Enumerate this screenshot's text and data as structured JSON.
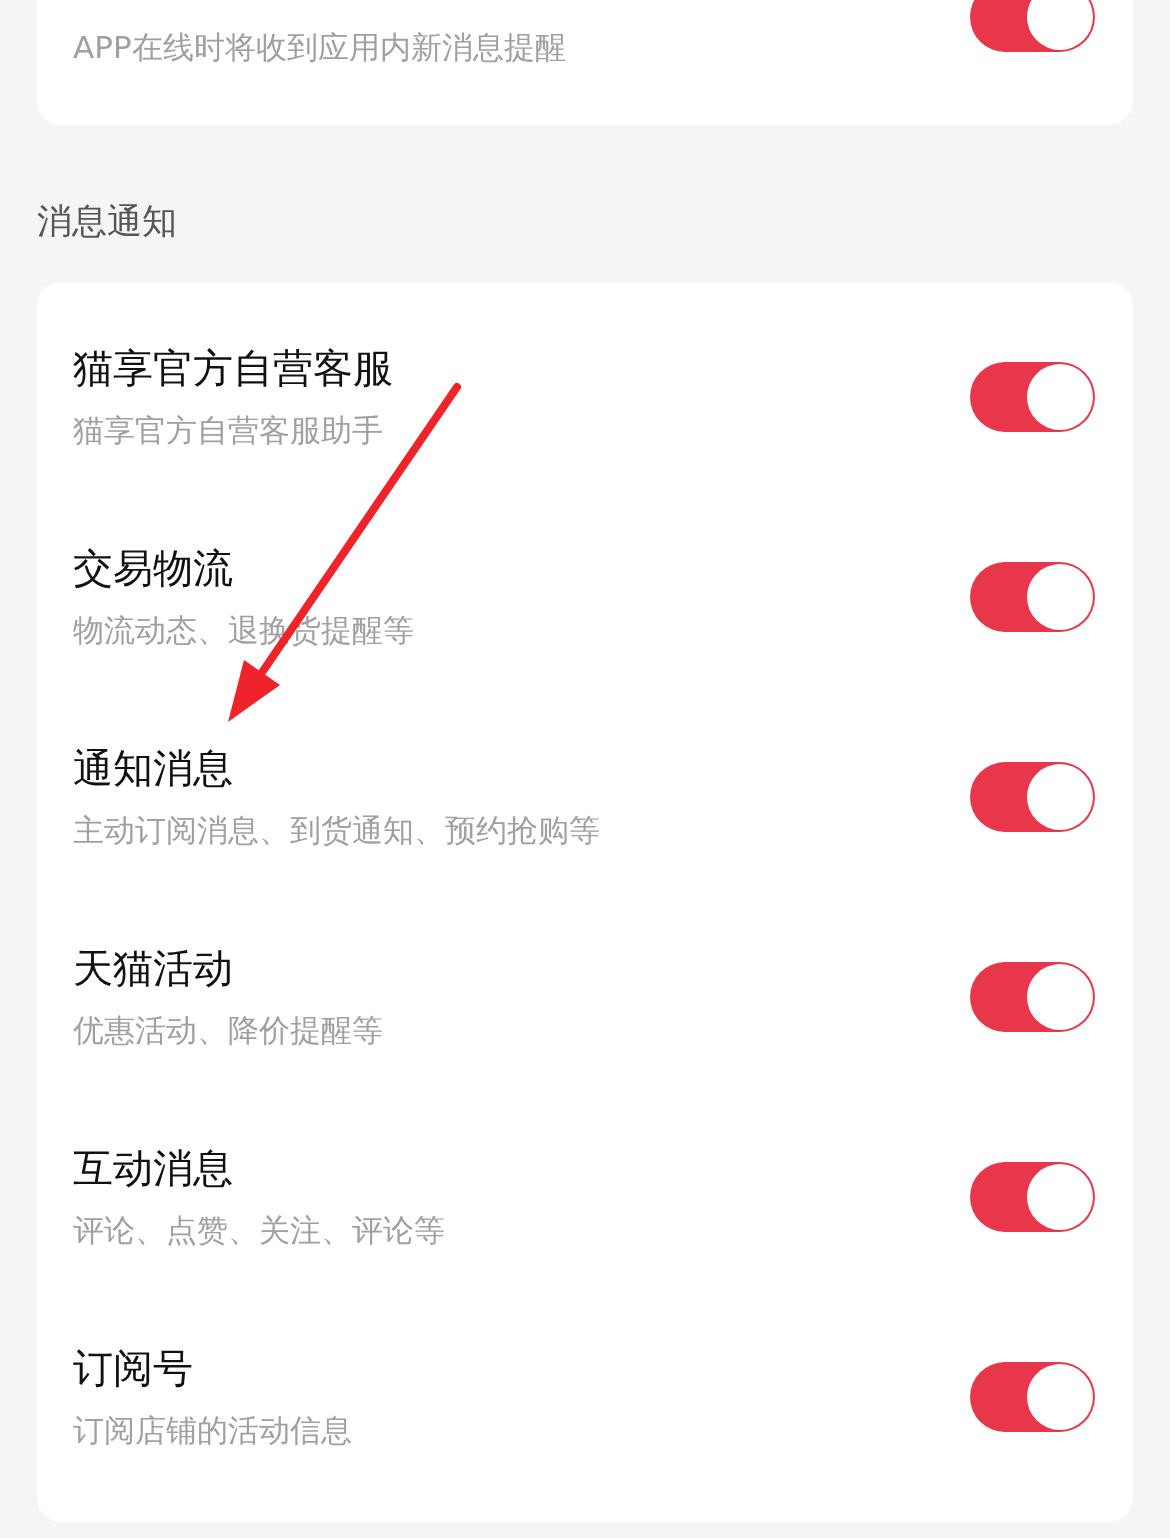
{
  "top_card": {
    "subtitle": "APP在线时将收到应用内新消息提醒",
    "on": true
  },
  "section": {
    "title": "消息通知",
    "items": [
      {
        "title": "猫享官方自营客服",
        "subtitle": "猫享官方自营客服助手",
        "on": true
      },
      {
        "title": "交易物流",
        "subtitle": "物流动态、退换货提醒等",
        "on": true
      },
      {
        "title": "通知消息",
        "subtitle": "主动订阅消息、到货通知、预约抢购等",
        "on": true
      },
      {
        "title": "天猫活动",
        "subtitle": "优惠活动、降价提醒等",
        "on": true
      },
      {
        "title": "互动消息",
        "subtitle": "评论、点赞、关注、评论等",
        "on": true
      },
      {
        "title": "订阅号",
        "subtitle": "订阅店铺的活动信息",
        "on": true
      }
    ]
  }
}
